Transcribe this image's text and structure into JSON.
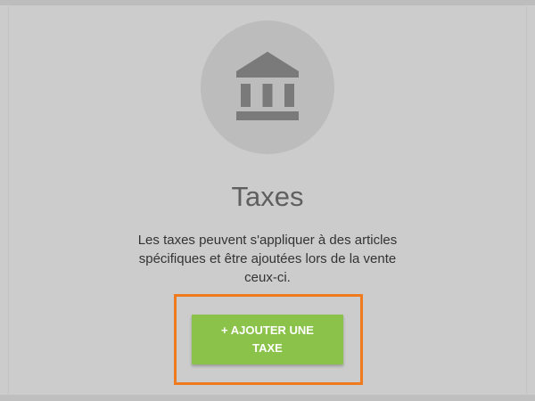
{
  "empty_state": {
    "icon": "bank-building-icon",
    "title": "Taxes",
    "description": "Les taxes peuvent s'appliquer à des articles spécifiques et être ajoutées lors de la vente ceux-ci.",
    "add_button_label": "+ AJOUTER UNE TAXE"
  },
  "colors": {
    "background": "#cccccc",
    "icon_circle": "#bcbcbc",
    "icon": "#7a7a7a",
    "title": "#5f5f5f",
    "button": "#8bc34a",
    "button_text": "#ffffff",
    "highlight": "#f07a1e"
  }
}
